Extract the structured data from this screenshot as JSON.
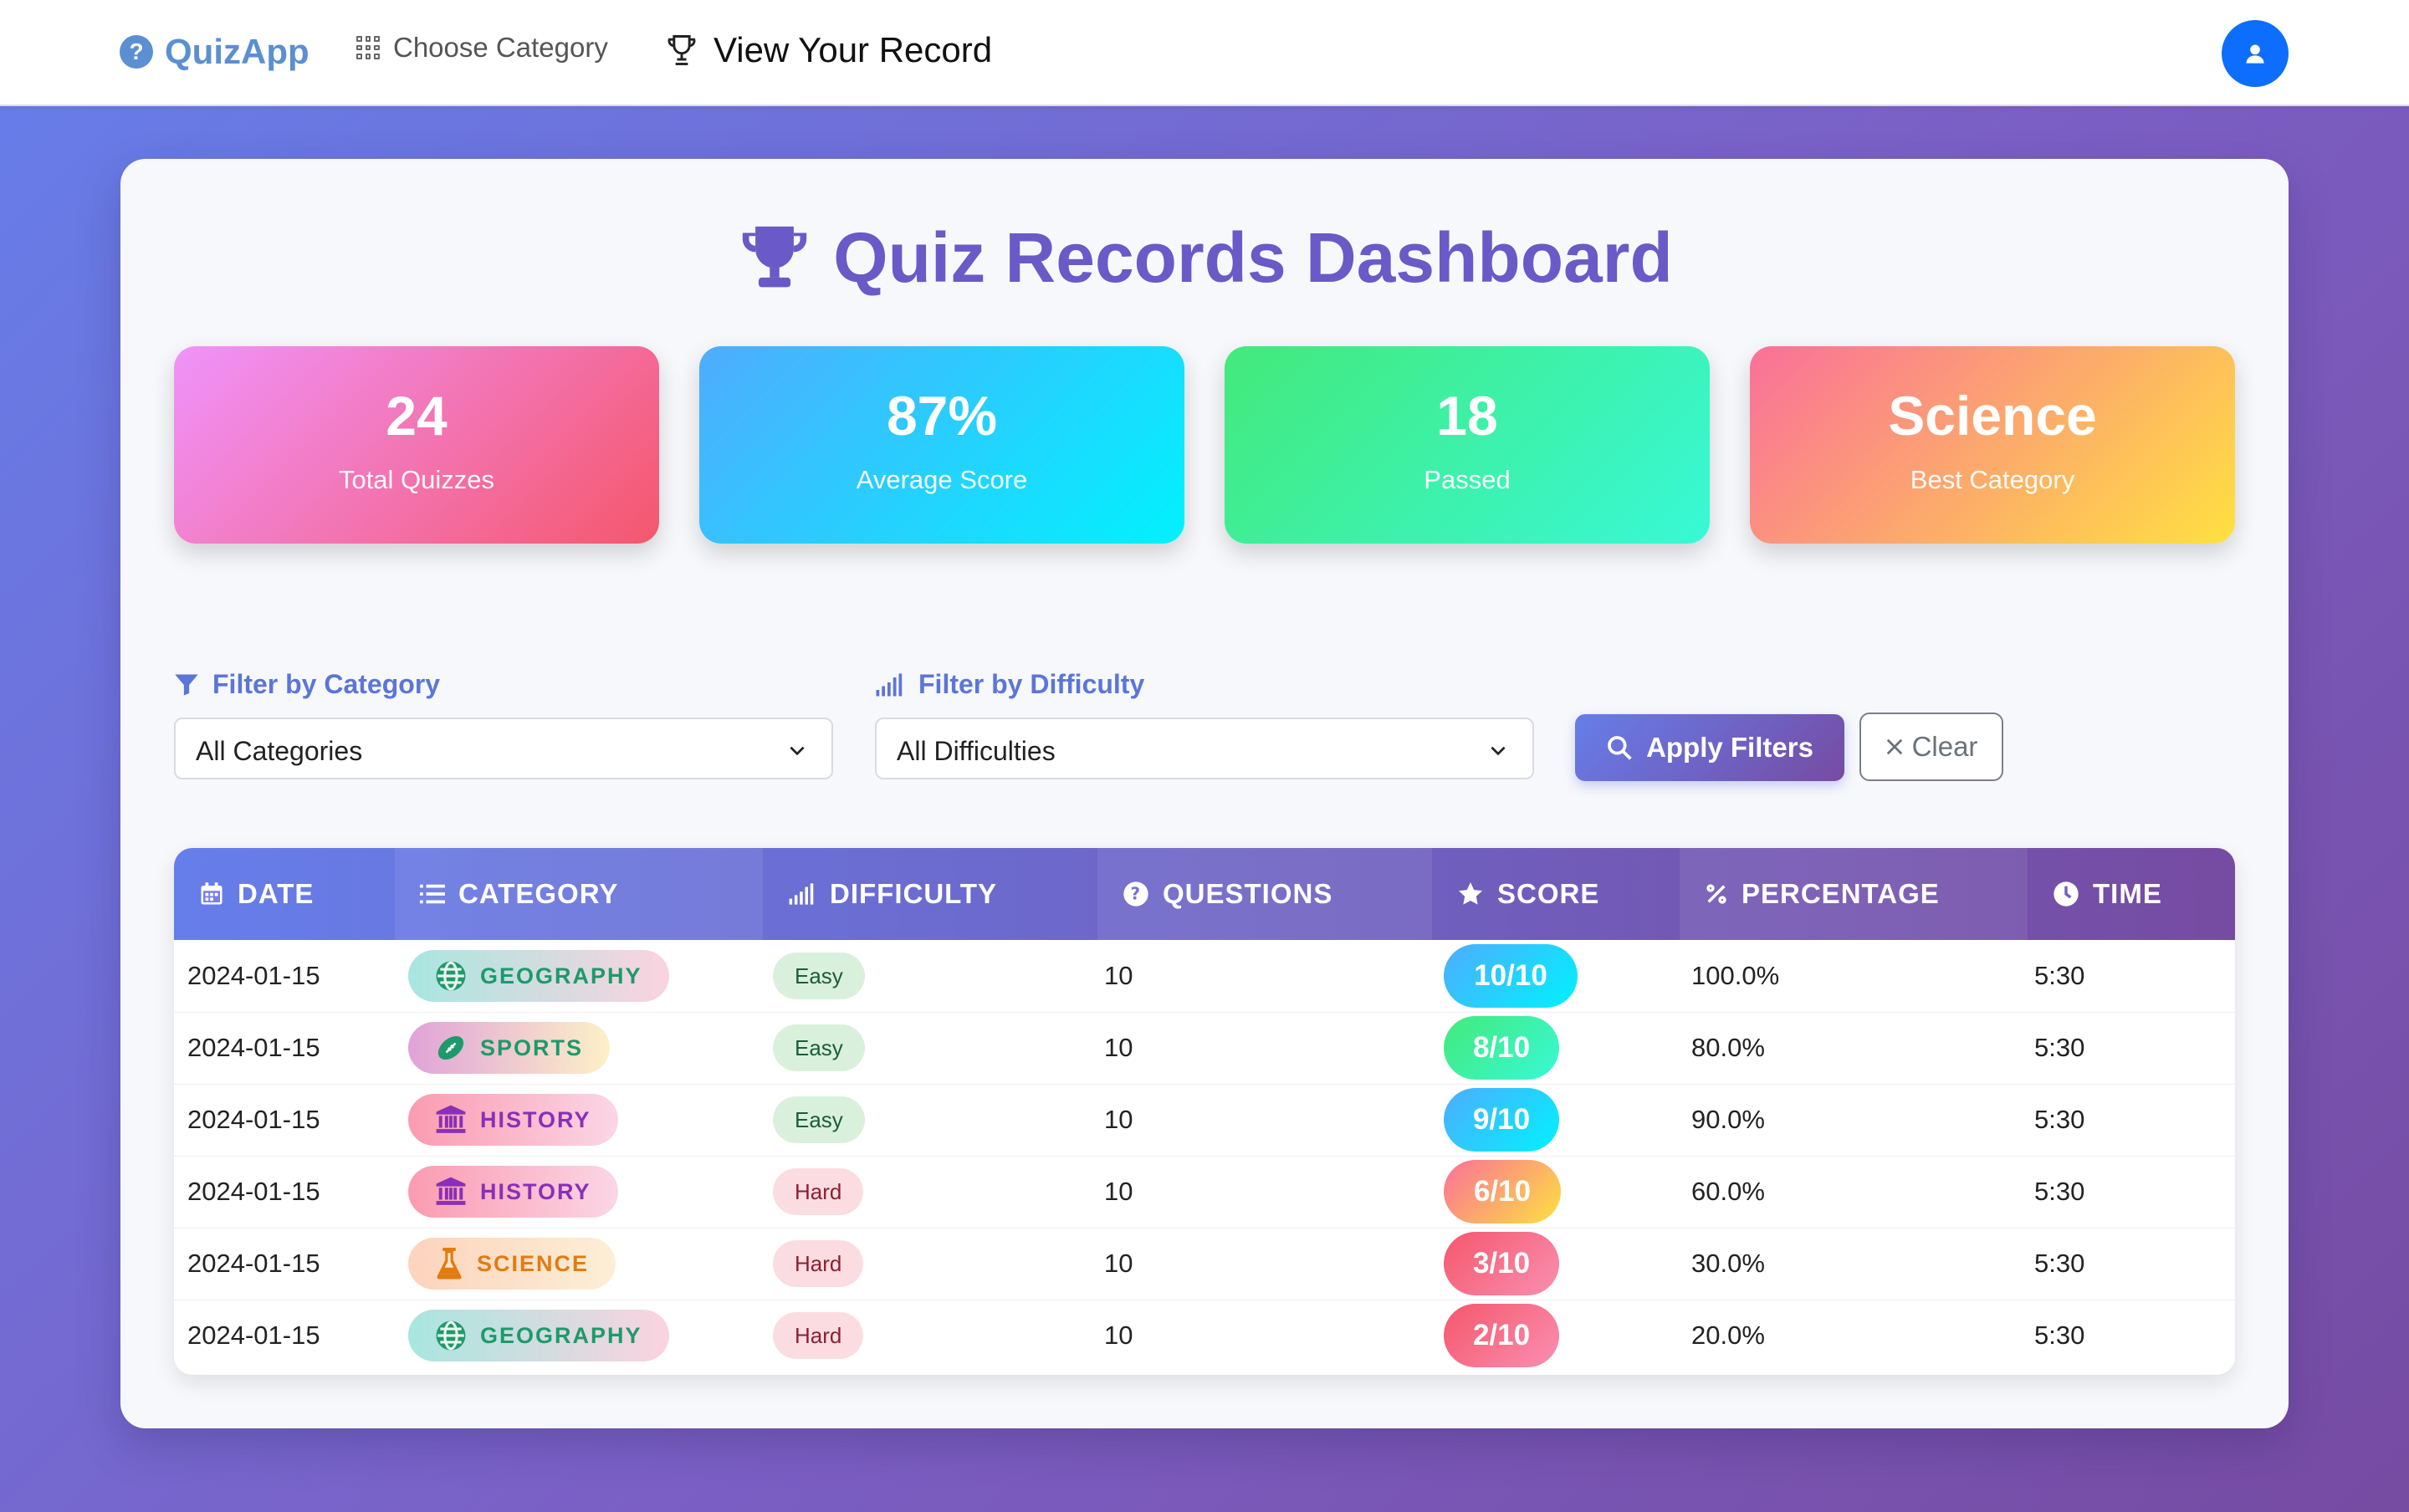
{
  "nav": {
    "brand": "QuizApp",
    "choose_category": "Choose Category",
    "view_record": "View Your Record"
  },
  "page": {
    "title": "Quiz Records Dashboard"
  },
  "stats": [
    {
      "value": "24",
      "label": "Total Quizzes"
    },
    {
      "value": "87%",
      "label": "Average Score"
    },
    {
      "value": "18",
      "label": "Passed"
    },
    {
      "value": "Science",
      "label": "Best Category"
    }
  ],
  "filters": {
    "category_label": "Filter by Category",
    "category_value": "All Categories",
    "difficulty_label": "Filter by Difficulty",
    "difficulty_value": "All Difficulties",
    "apply": "Apply Filters",
    "clear": "Clear"
  },
  "table": {
    "headers": [
      "DATE",
      "CATEGORY",
      "DIFFICULTY",
      "QUESTIONS",
      "SCORE",
      "PERCENTAGE",
      "TIME"
    ],
    "rows": [
      {
        "date": "2024-01-15",
        "category": "GEOGRAPHY",
        "difficulty": "Easy",
        "questions": "10",
        "score": "10/10",
        "percentage": "100.0%",
        "time": "5:30"
      },
      {
        "date": "2024-01-15",
        "category": "SPORTS",
        "difficulty": "Easy",
        "questions": "10",
        "score": "8/10",
        "percentage": "80.0%",
        "time": "5:30"
      },
      {
        "date": "2024-01-15",
        "category": "HISTORY",
        "difficulty": "Easy",
        "questions": "10",
        "score": "9/10",
        "percentage": "90.0%",
        "time": "5:30"
      },
      {
        "date": "2024-01-15",
        "category": "HISTORY",
        "difficulty": "Hard",
        "questions": "10",
        "score": "6/10",
        "percentage": "60.0%",
        "time": "5:30"
      },
      {
        "date": "2024-01-15",
        "category": "SCIENCE",
        "difficulty": "Hard",
        "questions": "10",
        "score": "3/10",
        "percentage": "30.0%",
        "time": "5:30"
      },
      {
        "date": "2024-01-15",
        "category": "GEOGRAPHY",
        "difficulty": "Hard",
        "questions": "10",
        "score": "2/10",
        "percentage": "20.0%",
        "time": "5:30"
      }
    ]
  },
  "colors": {
    "brand": "#5b8fd1",
    "title": "#6a5ac7",
    "header_gradient": [
      "#667eea",
      "#764ba2"
    ]
  },
  "icons": {
    "brand": "question-circle-icon",
    "choose_category": "grid-icon",
    "view_record": "trophy-icon",
    "title": "trophy-icon",
    "category_filter": "funnel-icon",
    "difficulty_filter": "signal-bars-icon",
    "apply": "search-icon",
    "clear": "close-icon",
    "avatar": "user-icon"
  }
}
